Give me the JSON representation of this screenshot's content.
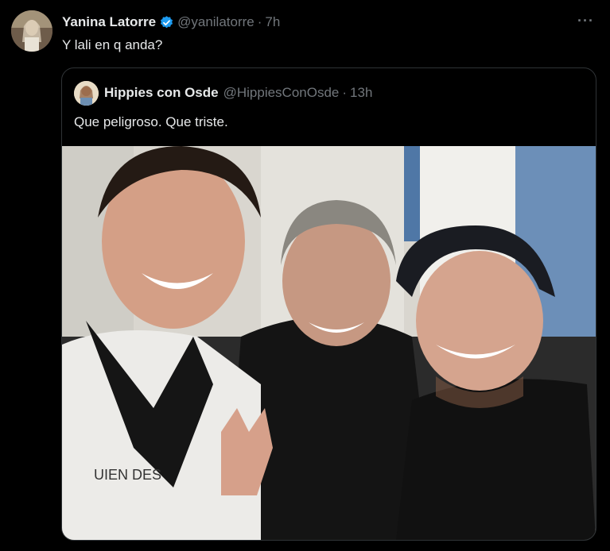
{
  "tweet": {
    "author_name": "Yanina Latorre",
    "handle": "@yanilatorre",
    "separator": "·",
    "time": "7h",
    "text": "Y lali en q anda?",
    "more_icon": "more-horizontal-icon",
    "verified_icon": "verified-badge-icon"
  },
  "quoted": {
    "author_name": "Hippies con Osde",
    "handle": "@HippiesConOsde",
    "separator": "·",
    "time": "13h",
    "text": "Que peligroso. Que triste.",
    "photo_shirt_text": "UIEN DES"
  },
  "colors": {
    "background": "#000000",
    "text": "#e7e9ea",
    "muted": "#71767b",
    "border": "#2f3336",
    "verified": "#1d9bf0"
  }
}
